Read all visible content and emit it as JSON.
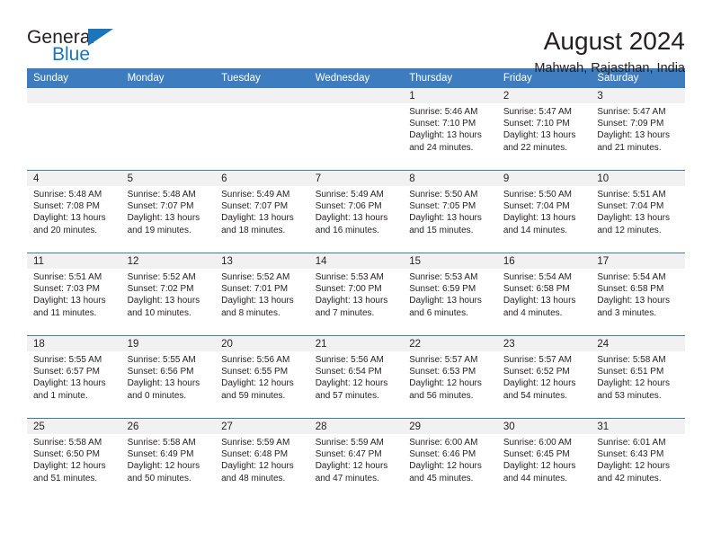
{
  "brand": {
    "name_part1": "General",
    "name_part2": "Blue"
  },
  "header": {
    "title": "August 2024",
    "subtitle": "Mahwah, Rajasthan, India"
  },
  "colors": {
    "header_blue": "#3d7cbf",
    "brand_blue": "#1b75bb",
    "date_band_gray": "#f1f1f1",
    "text": "#231f20"
  },
  "weekdays": [
    "Sunday",
    "Monday",
    "Tuesday",
    "Wednesday",
    "Thursday",
    "Friday",
    "Saturday"
  ],
  "labels": {
    "sunrise_prefix": "Sunrise:",
    "sunset_prefix": "Sunset:",
    "daylight_prefix": "Daylight:"
  },
  "weeks": [
    [
      {
        "date": "",
        "blank": true
      },
      {
        "date": "",
        "blank": true
      },
      {
        "date": "",
        "blank": true
      },
      {
        "date": "",
        "blank": true
      },
      {
        "date": "1",
        "sunrise": "Sunrise: 5:46 AM",
        "sunset": "Sunset: 7:10 PM",
        "daylight": "Daylight: 13 hours and 24 minutes."
      },
      {
        "date": "2",
        "sunrise": "Sunrise: 5:47 AM",
        "sunset": "Sunset: 7:10 PM",
        "daylight": "Daylight: 13 hours and 22 minutes."
      },
      {
        "date": "3",
        "sunrise": "Sunrise: 5:47 AM",
        "sunset": "Sunset: 7:09 PM",
        "daylight": "Daylight: 13 hours and 21 minutes."
      }
    ],
    [
      {
        "date": "4",
        "sunrise": "Sunrise: 5:48 AM",
        "sunset": "Sunset: 7:08 PM",
        "daylight": "Daylight: 13 hours and 20 minutes."
      },
      {
        "date": "5",
        "sunrise": "Sunrise: 5:48 AM",
        "sunset": "Sunset: 7:07 PM",
        "daylight": "Daylight: 13 hours and 19 minutes."
      },
      {
        "date": "6",
        "sunrise": "Sunrise: 5:49 AM",
        "sunset": "Sunset: 7:07 PM",
        "daylight": "Daylight: 13 hours and 18 minutes."
      },
      {
        "date": "7",
        "sunrise": "Sunrise: 5:49 AM",
        "sunset": "Sunset: 7:06 PM",
        "daylight": "Daylight: 13 hours and 16 minutes."
      },
      {
        "date": "8",
        "sunrise": "Sunrise: 5:50 AM",
        "sunset": "Sunset: 7:05 PM",
        "daylight": "Daylight: 13 hours and 15 minutes."
      },
      {
        "date": "9",
        "sunrise": "Sunrise: 5:50 AM",
        "sunset": "Sunset: 7:04 PM",
        "daylight": "Daylight: 13 hours and 14 minutes."
      },
      {
        "date": "10",
        "sunrise": "Sunrise: 5:51 AM",
        "sunset": "Sunset: 7:04 PM",
        "daylight": "Daylight: 13 hours and 12 minutes."
      }
    ],
    [
      {
        "date": "11",
        "sunrise": "Sunrise: 5:51 AM",
        "sunset": "Sunset: 7:03 PM",
        "daylight": "Daylight: 13 hours and 11 minutes."
      },
      {
        "date": "12",
        "sunrise": "Sunrise: 5:52 AM",
        "sunset": "Sunset: 7:02 PM",
        "daylight": "Daylight: 13 hours and 10 minutes."
      },
      {
        "date": "13",
        "sunrise": "Sunrise: 5:52 AM",
        "sunset": "Sunset: 7:01 PM",
        "daylight": "Daylight: 13 hours and 8 minutes."
      },
      {
        "date": "14",
        "sunrise": "Sunrise: 5:53 AM",
        "sunset": "Sunset: 7:00 PM",
        "daylight": "Daylight: 13 hours and 7 minutes."
      },
      {
        "date": "15",
        "sunrise": "Sunrise: 5:53 AM",
        "sunset": "Sunset: 6:59 PM",
        "daylight": "Daylight: 13 hours and 6 minutes."
      },
      {
        "date": "16",
        "sunrise": "Sunrise: 5:54 AM",
        "sunset": "Sunset: 6:58 PM",
        "daylight": "Daylight: 13 hours and 4 minutes."
      },
      {
        "date": "17",
        "sunrise": "Sunrise: 5:54 AM",
        "sunset": "Sunset: 6:58 PM",
        "daylight": "Daylight: 13 hours and 3 minutes."
      }
    ],
    [
      {
        "date": "18",
        "sunrise": "Sunrise: 5:55 AM",
        "sunset": "Sunset: 6:57 PM",
        "daylight": "Daylight: 13 hours and 1 minute."
      },
      {
        "date": "19",
        "sunrise": "Sunrise: 5:55 AM",
        "sunset": "Sunset: 6:56 PM",
        "daylight": "Daylight: 13 hours and 0 minutes."
      },
      {
        "date": "20",
        "sunrise": "Sunrise: 5:56 AM",
        "sunset": "Sunset: 6:55 PM",
        "daylight": "Daylight: 12 hours and 59 minutes."
      },
      {
        "date": "21",
        "sunrise": "Sunrise: 5:56 AM",
        "sunset": "Sunset: 6:54 PM",
        "daylight": "Daylight: 12 hours and 57 minutes."
      },
      {
        "date": "22",
        "sunrise": "Sunrise: 5:57 AM",
        "sunset": "Sunset: 6:53 PM",
        "daylight": "Daylight: 12 hours and 56 minutes."
      },
      {
        "date": "23",
        "sunrise": "Sunrise: 5:57 AM",
        "sunset": "Sunset: 6:52 PM",
        "daylight": "Daylight: 12 hours and 54 minutes."
      },
      {
        "date": "24",
        "sunrise": "Sunrise: 5:58 AM",
        "sunset": "Sunset: 6:51 PM",
        "daylight": "Daylight: 12 hours and 53 minutes."
      }
    ],
    [
      {
        "date": "25",
        "sunrise": "Sunrise: 5:58 AM",
        "sunset": "Sunset: 6:50 PM",
        "daylight": "Daylight: 12 hours and 51 minutes."
      },
      {
        "date": "26",
        "sunrise": "Sunrise: 5:58 AM",
        "sunset": "Sunset: 6:49 PM",
        "daylight": "Daylight: 12 hours and 50 minutes."
      },
      {
        "date": "27",
        "sunrise": "Sunrise: 5:59 AM",
        "sunset": "Sunset: 6:48 PM",
        "daylight": "Daylight: 12 hours and 48 minutes."
      },
      {
        "date": "28",
        "sunrise": "Sunrise: 5:59 AM",
        "sunset": "Sunset: 6:47 PM",
        "daylight": "Daylight: 12 hours and 47 minutes."
      },
      {
        "date": "29",
        "sunrise": "Sunrise: 6:00 AM",
        "sunset": "Sunset: 6:46 PM",
        "daylight": "Daylight: 12 hours and 45 minutes."
      },
      {
        "date": "30",
        "sunrise": "Sunrise: 6:00 AM",
        "sunset": "Sunset: 6:45 PM",
        "daylight": "Daylight: 12 hours and 44 minutes."
      },
      {
        "date": "31",
        "sunrise": "Sunrise: 6:01 AM",
        "sunset": "Sunset: 6:43 PM",
        "daylight": "Daylight: 12 hours and 42 minutes."
      }
    ]
  ]
}
